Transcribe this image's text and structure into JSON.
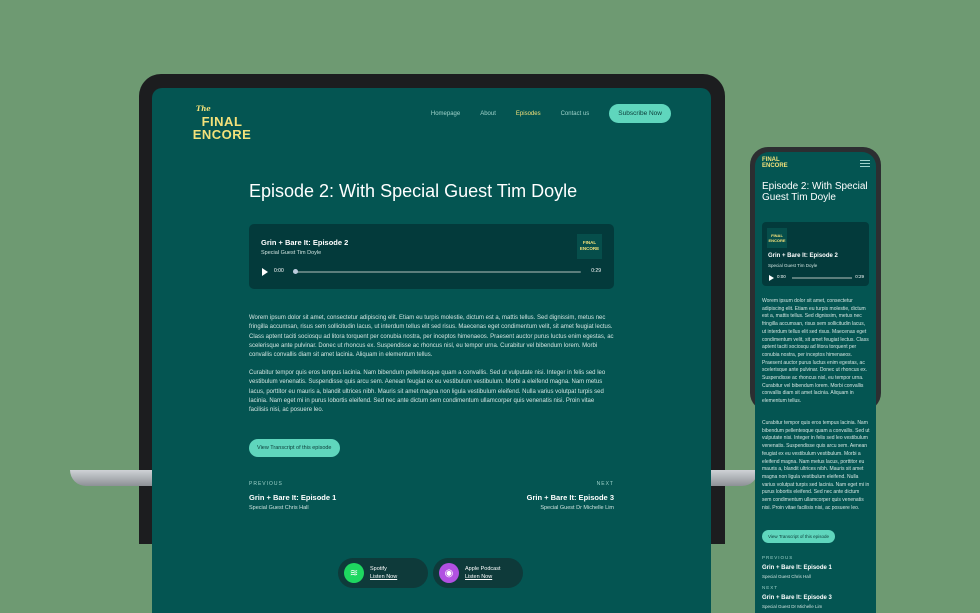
{
  "logo": {
    "the": "The",
    "line1": "FINAL",
    "line2": "ENCORE"
  },
  "nav": {
    "homepage": "Homepage",
    "about": "About",
    "episodes": "Episodes",
    "contact": "Contact us",
    "subscribe": "Subscribe Now"
  },
  "episode": {
    "title": "Episode 2:  With Special Guest Tim Doyle"
  },
  "player": {
    "title": "Grin + Bare It: Episode 2",
    "subtitle": "Special Guest Tim Doyle",
    "current_time": "0:00",
    "duration": "0:29",
    "art": "FINAL ENCORE"
  },
  "body": {
    "p1": "Worem ipsum dolor sit amet, consectetur adipiscing elit. Etiam eu turpis molestie, dictum est a, mattis tellus. Sed dignissim, metus nec fringilla accumsan, risus sem sollicitudin lacus, ut interdum tellus elit sed risus. Maecenas eget condimentum velit, sit amet feugiat lectus. Class aptent taciti sociosqu ad litora torquent per conubia nostra, per inceptos himenaeos. Praesent auctor purus luctus enim egestas, ac scelerisque ante pulvinar. Donec ut rhoncus ex. Suspendisse ac rhoncus nisl, eu tempor urna. Curabitur vel bibendum lorem. Morbi convallis convallis diam sit amet lacinia. Aliquam in elementum tellus.",
    "p2": "Curabitur tempor quis eros tempus lacinia. Nam bibendum pellentesque quam a convallis. Sed ut vulputate nisi. Integer in felis sed leo vestibulum venenatis. Suspendisse quis arcu sem. Aenean feugiat ex eu vestibulum vestibulum. Morbi a eleifend magna. Nam metus lacus, porttitor eu mauris a, blandit ultrices nibh. Mauris sit amet magna non ligula vestibulum eleifend. Nulla varius volutpat turpis sed lacinia. Nam eget mi in purus lobortis eleifend. Sed nec ante dictum sem condimentum ullamcorper quis venenatis nisi. Proin vitae facilisis nisi, ac posuere leo."
  },
  "transcript_button": "View Transcript of this episode",
  "prev": {
    "label": "PREVIOUS",
    "title": "Grin + Bare It: Episode 1",
    "guest": "Special Guest Chris Hall"
  },
  "next": {
    "label": "NEXT",
    "title": "Grin + Bare It: Episode 3",
    "guest": "Special Guest Dr Michelle Lim"
  },
  "podcasts": {
    "spotify": {
      "name": "Spotify",
      "cta": "Listen Now"
    },
    "apple": {
      "name": "Apple Podcast",
      "cta": "Listen Now"
    }
  },
  "mobile": {
    "title": "Episode 2:  With Special Guest Tim Doyle"
  }
}
